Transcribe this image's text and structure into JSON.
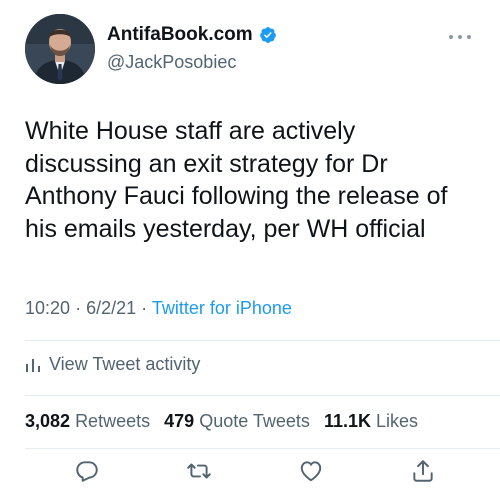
{
  "author": {
    "display_name": "AntifaBook.com",
    "handle": "@JackPosobiec",
    "verified": true
  },
  "tweet": {
    "text": "White House staff are actively\ndiscussing an exit strategy for Dr\nAnthony Fauci following the release of\nhis emails yesterday, per WH official",
    "time": "10:20",
    "date": "6/2/21",
    "separator": "·",
    "source": "Twitter for iPhone"
  },
  "activity": {
    "label": "View Tweet activity"
  },
  "stats": {
    "retweets_count": "3,082",
    "retweets_label": "Retweets",
    "quotes_count": "479",
    "quotes_label": "Quote Tweets",
    "likes_count": "11.1K",
    "likes_label": "Likes"
  },
  "icons": {
    "more": "more-icon",
    "verified": "verified-badge-icon",
    "activity": "bar-chart-icon",
    "reply": "reply-icon",
    "retweet": "retweet-icon",
    "like": "heart-icon",
    "share": "share-icon"
  },
  "colors": {
    "accent": "#1d9bf0",
    "secondary_text": "#536471",
    "primary_text": "#0f1419"
  }
}
